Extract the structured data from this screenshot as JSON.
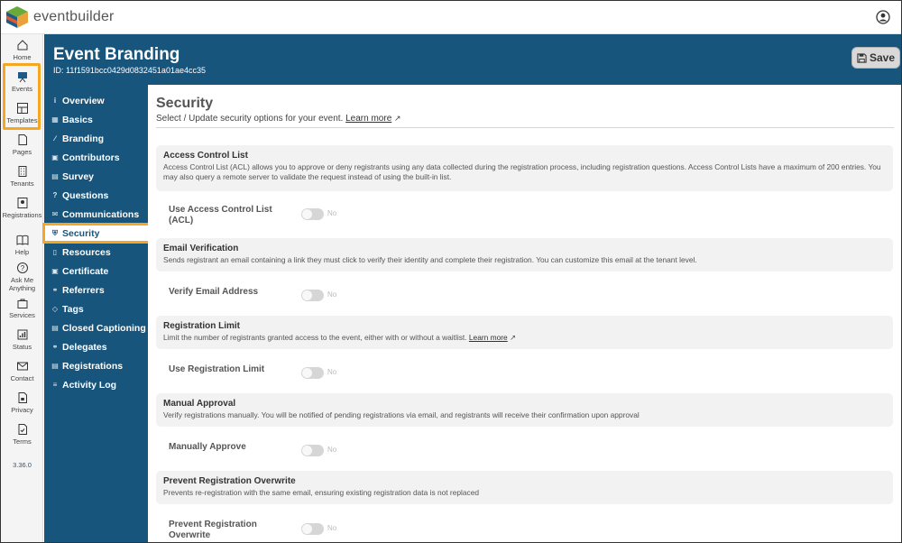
{
  "app": {
    "brand": "eventbuilder",
    "version": "3.36.0"
  },
  "rail": {
    "items": [
      {
        "label": "Home",
        "icon": "home-icon"
      },
      {
        "label": "Events",
        "icon": "easel-icon"
      },
      {
        "label": "Templates",
        "icon": "layout-icon"
      },
      {
        "label": "Pages",
        "icon": "page-icon"
      },
      {
        "label": "Tenants",
        "icon": "building-icon"
      },
      {
        "label": "Registrations",
        "icon": "badge-icon"
      },
      {
        "label": "Help",
        "icon": "book-icon"
      },
      {
        "label": "Ask Me Anything",
        "icon": "question-icon"
      },
      {
        "label": "Services",
        "icon": "bag-icon"
      },
      {
        "label": "Status",
        "icon": "chart-icon"
      },
      {
        "label": "Contact",
        "icon": "mail-icon"
      },
      {
        "label": "Privacy",
        "icon": "lock-doc-icon"
      },
      {
        "label": "Terms",
        "icon": "check-doc-icon"
      }
    ]
  },
  "header": {
    "title": "Event Branding",
    "event_id": "ID: 11f1591bcc0429d0832451a01ae4cc35",
    "save_label": "Save"
  },
  "nav": {
    "items": [
      {
        "label": "Overview",
        "icon": "info-icon"
      },
      {
        "label": "Basics",
        "icon": "grid-icon"
      },
      {
        "label": "Branding",
        "icon": "brush-icon"
      },
      {
        "label": "Contributors",
        "icon": "contributors-icon"
      },
      {
        "label": "Survey",
        "icon": "survey-icon"
      },
      {
        "label": "Questions",
        "icon": "question-icon"
      },
      {
        "label": "Communications",
        "icon": "mail-icon"
      },
      {
        "label": "Security",
        "icon": "shield-icon"
      },
      {
        "label": "Resources",
        "icon": "resources-icon"
      },
      {
        "label": "Certificate",
        "icon": "certificate-icon"
      },
      {
        "label": "Referrers",
        "icon": "referrers-icon"
      },
      {
        "label": "Tags",
        "icon": "tag-icon"
      },
      {
        "label": "Closed Captioning",
        "icon": "cc-icon"
      },
      {
        "label": "Delegates",
        "icon": "delegates-icon"
      },
      {
        "label": "Registrations",
        "icon": "registrations-icon"
      },
      {
        "label": "Activity Log",
        "icon": "list-icon"
      }
    ],
    "active": "Security"
  },
  "page": {
    "title": "Security",
    "subtitle": "Select / Update security options for your event.",
    "learn_more": "Learn more"
  },
  "sections": [
    {
      "title": "Access Control List",
      "desc": "Access Control List (ACL) allows you to approve or deny registrants using any data collected during the registration process, including registration questions. Access Control Lists have a maximum of 200 entries. You may also query a remote server to validate the request instead of using the built-in list.",
      "option_label": "Use Access Control List (ACL)",
      "toggle_state": "No"
    },
    {
      "title": "Email Verification",
      "desc": "Sends registrant an email containing a link they must click to verify their identity and complete their registration. You can customize this email at the tenant level.",
      "option_label": "Verify Email Address",
      "toggle_state": "No"
    },
    {
      "title": "Registration Limit",
      "desc": "Limit the number of registrants granted access to the event, either with or without a waitlist.",
      "learn_more": "Learn more",
      "option_label": "Use Registration Limit",
      "toggle_state": "No"
    },
    {
      "title": "Manual Approval",
      "desc": "Verify registrations manually. You will be notified of pending registrations via email, and registrants will receive their confirmation upon approval",
      "option_label": "Manually Approve",
      "toggle_state": "No"
    },
    {
      "title": "Prevent Registration Overwrite",
      "desc": "Prevents re-registration with the same email, ensuring existing registration data is not replaced",
      "option_label": "Prevent Registration Overwrite",
      "toggle_state": "No"
    }
  ],
  "colors": {
    "primary": "#17557d",
    "highlight": "#f5a623"
  }
}
